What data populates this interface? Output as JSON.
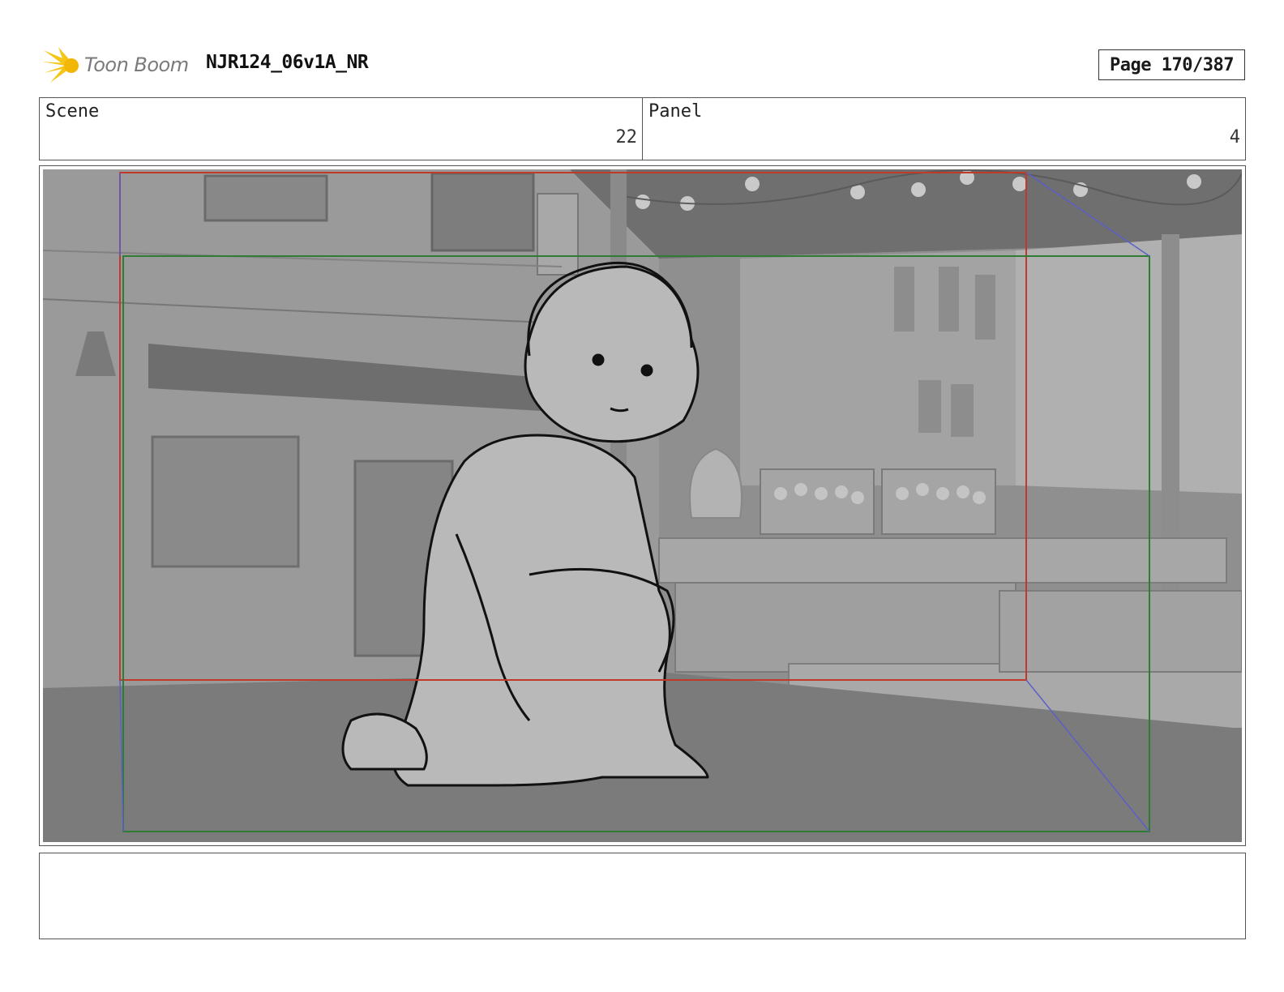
{
  "header": {
    "logo_text": "Toon Boom",
    "logo_icon": "sun-burst-icon",
    "project_title": "NJR124_06v1A_NR",
    "page_label": "Page 170/387"
  },
  "info": {
    "scene_label": "Scene",
    "scene_value": "22",
    "panel_label": "Panel",
    "panel_value": "4"
  },
  "notes": {
    "text": ""
  },
  "colors": {
    "safe_frame": "#c0392b",
    "camera_frame": "#2e7d32",
    "camera_path": "#5b5fc7",
    "background_gray": "#8e8e8e"
  }
}
